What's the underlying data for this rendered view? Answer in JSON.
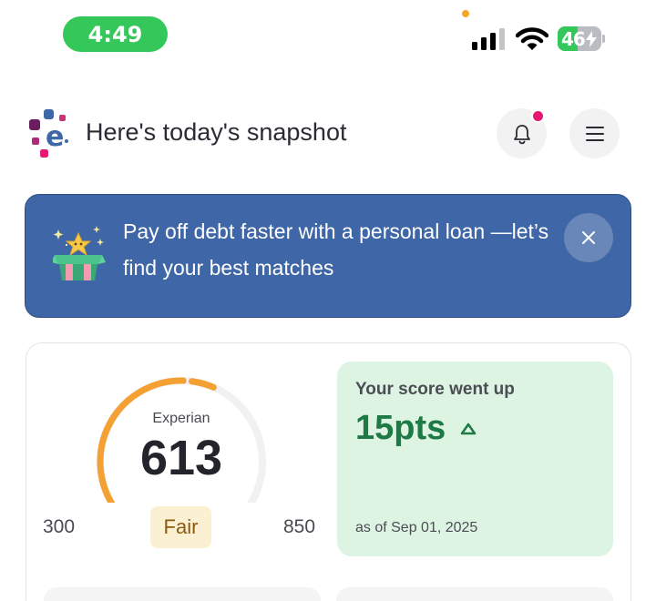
{
  "status_bar": {
    "time": "4:49",
    "battery_text": "46",
    "battery_level": 0.46
  },
  "header": {
    "title": "Here's today's snapshot",
    "logo_icon": "experian-logo-icon",
    "notification_icon": "bell-icon",
    "menu_icon": "hamburger-menu-icon"
  },
  "banner": {
    "text": "Pay off debt faster with a personal loan —let’s find your best matches",
    "icon": "gift-box-icon",
    "close_icon": "close-icon"
  },
  "score": {
    "bureau": "Experian",
    "value": "613",
    "range_min": "300",
    "range_max": "850",
    "rating": "Fair"
  },
  "score_change": {
    "title": "Your score went up",
    "value": "15pts",
    "direction_icon": "triangle-up-icon",
    "date": "as of Sep 01, 2025"
  },
  "colors": {
    "accent_blue": "#3f66a6",
    "gauge_orange": "#f5a033",
    "positive_green": "#1e7a45",
    "notification_pink": "#e6176f"
  }
}
